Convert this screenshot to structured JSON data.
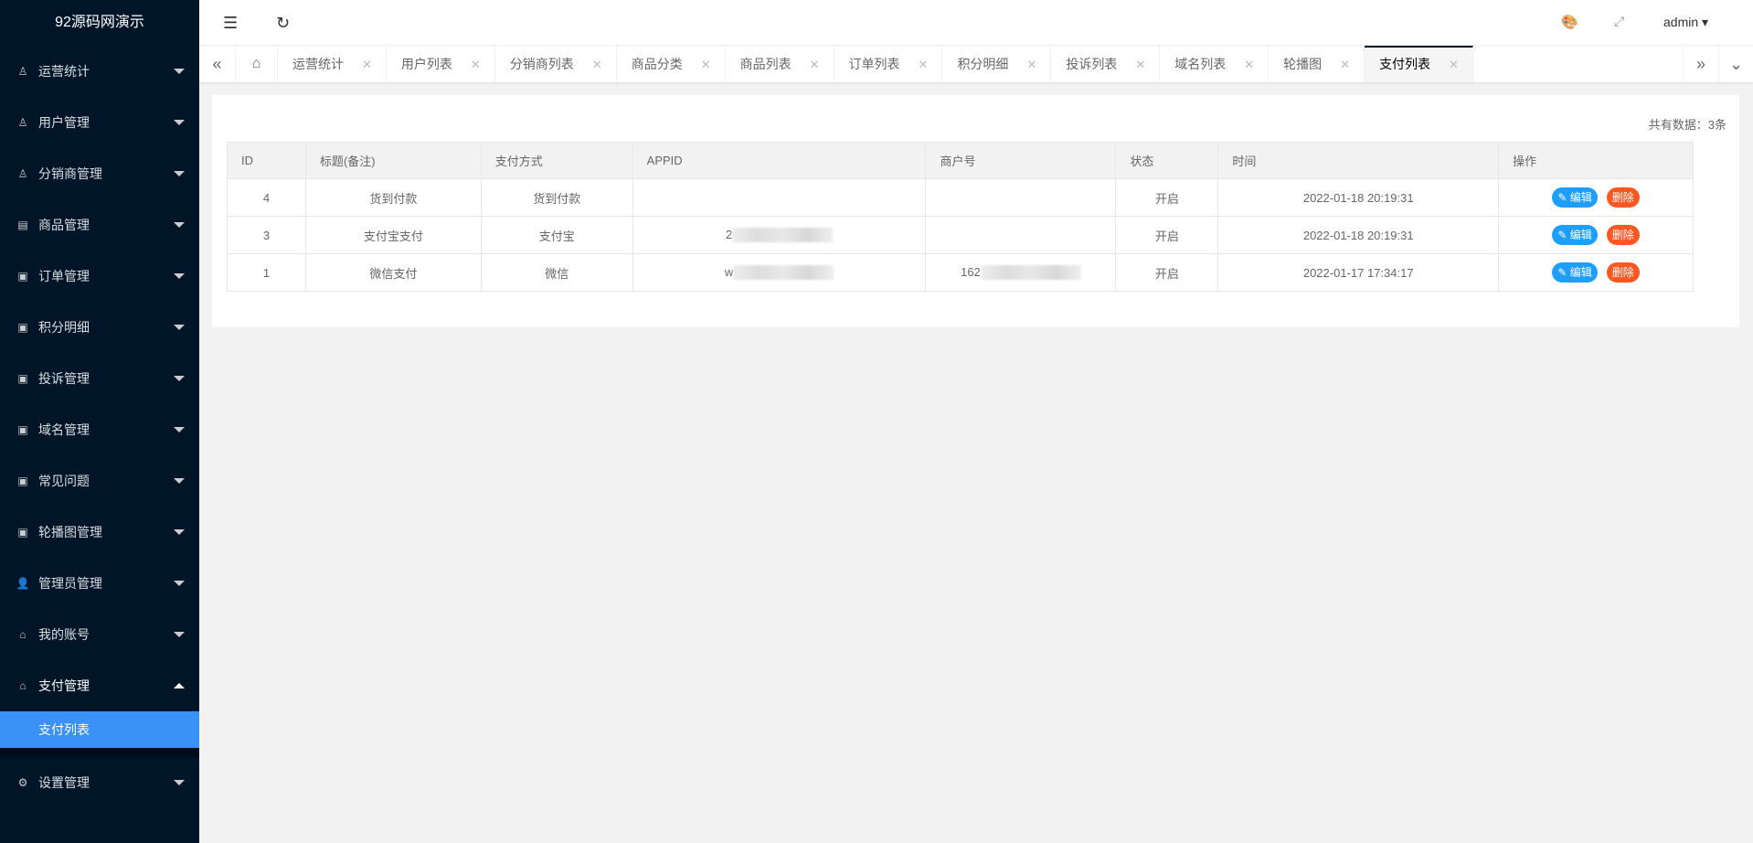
{
  "app_title": "92源码网演示",
  "sidebar": {
    "items": [
      {
        "label": "运营统计",
        "icon": "user-icon"
      },
      {
        "label": "用户管理",
        "icon": "user-icon"
      },
      {
        "label": "分销商管理",
        "icon": "user-icon"
      },
      {
        "label": "商品管理",
        "icon": "document-icon"
      },
      {
        "label": "订单管理",
        "icon": "image-icon"
      },
      {
        "label": "积分明细",
        "icon": "image-icon"
      },
      {
        "label": "投诉管理",
        "icon": "image-icon"
      },
      {
        "label": "域名管理",
        "icon": "image-icon"
      },
      {
        "label": "常见问题",
        "icon": "image-icon"
      },
      {
        "label": "轮播图管理",
        "icon": "image-icon"
      },
      {
        "label": "管理员管理",
        "icon": "person-icon"
      },
      {
        "label": "我的账号",
        "icon": "home-icon"
      },
      {
        "label": "支付管理",
        "icon": "home-icon",
        "sub": "支付列表"
      },
      {
        "label": "设置管理",
        "icon": "gear-icon"
      }
    ]
  },
  "header": {
    "user": "admin"
  },
  "tabs": [
    "运营统计",
    "用户列表",
    "分销商列表",
    "商品分类",
    "商品列表",
    "订单列表",
    "积分明细",
    "投诉列表",
    "域名列表",
    "轮播图",
    "支付列表"
  ],
  "active_tab": "支付列表",
  "count_text": "共有数据：3条",
  "table": {
    "headers": [
      "ID",
      "标题(备注)",
      "支付方式",
      "APPID",
      "商户号",
      "状态",
      "时间",
      "操作"
    ],
    "rows": [
      {
        "id": "4",
        "title": "货到付款",
        "method": "货到付款",
        "appid": "",
        "mch": "",
        "status": "开启",
        "time": "2022-01-18 20:19:31"
      },
      {
        "id": "3",
        "title": "支付宝支付",
        "method": "支付宝",
        "appid": "2",
        "mch": "",
        "status": "开启",
        "time": "2022-01-18 20:19:31"
      },
      {
        "id": "1",
        "title": "微信支付",
        "method": "微信",
        "appid": "w",
        "mch": "162",
        "status": "开启",
        "time": "2022-01-17 17:34:17"
      }
    ],
    "edit_label": "编辑",
    "delete_label": "删除"
  }
}
